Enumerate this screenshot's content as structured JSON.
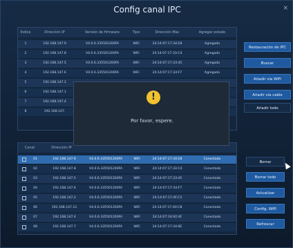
{
  "window": {
    "title": "Config canal IPC",
    "close": "×"
  },
  "top_table": {
    "headers": [
      "Índice",
      "Dirección IP",
      "Versión de firmware",
      "Tipo",
      "Dirección Mac",
      "Agregar estado"
    ],
    "rows": [
      [
        "1",
        "192.168.147.9",
        "V4.0.6.335501200FA",
        "WiFi",
        "24:14:07:17:34:E8",
        "Agregado"
      ],
      [
        "2",
        "192.168.147.8",
        "V4.0.6.335501200FA",
        "WiFi",
        "24:14:07:17:33:C4",
        "Agregado"
      ],
      [
        "3",
        "192.168.147.5",
        "V4.0.6.335501200FA",
        "WiFi",
        "24:14:07:17:33:45",
        "Agregado"
      ],
      [
        "4",
        "192.168.147.6",
        "V4.0.6.335501200FA",
        "WiFi",
        "24:14:07:17:34:F7",
        "Agregado"
      ],
      [
        "5",
        "192.168.147.2",
        "",
        "",
        "",
        ""
      ],
      [
        "6",
        "192.168.147.1",
        "",
        "",
        "",
        ""
      ],
      [
        "7",
        "192.168.147.4",
        "",
        "",
        "",
        ""
      ],
      [
        "8",
        "192.168.147.",
        "",
        "",
        "",
        ""
      ]
    ]
  },
  "bottom_table": {
    "headers": [
      "Canal",
      "Dirección IP",
      "",
      "",
      "",
      ""
    ],
    "rows": [
      [
        "01",
        "192.168.147.9",
        "V4.0.6.335501200FA",
        "WiFi",
        "24:14:07:17:34:E8",
        "Conectado"
      ],
      [
        "02",
        "192.168.147.8",
        "V4.0.6.335501200FA",
        "WiFi",
        "24:14:07:17:33:C4",
        "Conectado"
      ],
      [
        "03",
        "192.168.147.5",
        "V4.0.6.335501200FA",
        "WiFi",
        "24:14:07:17:33:45",
        "Conectado"
      ],
      [
        "04",
        "192.168.147.6",
        "V4.0.6.335501200FA",
        "WiFi",
        "24:14:07:17:34:F7",
        "Conectado"
      ],
      [
        "05",
        "192.168.147.2",
        "V4.0.6.335501200FA",
        "WiFi",
        "24:14:07:17:4F:C3",
        "Conectado"
      ],
      [
        "06",
        "192.168.147.12",
        "V4.0.6.335501200FA",
        "WiFi",
        "24:14:07:17:40:C8",
        "Conectado"
      ],
      [
        "07",
        "192.168.147.4",
        "V4.0.6.335501200FA",
        "WiFi",
        "24:14:07:16:92:4F",
        "Conectado"
      ],
      [
        "08",
        "192.168.147.7",
        "V4.0.6.335501200FA",
        "WiFi",
        "24:14:07:17:34:8E",
        "Conectado"
      ]
    ]
  },
  "buttons_top": [
    "Restauración de IPC",
    "Buscar",
    "Añadir vía WiFi",
    "Añadir vía cable",
    "Añadir todo"
  ],
  "buttons_bottom": [
    "Borrar",
    "Borrar todo",
    "Actualizar",
    "Config. WiFi",
    "Refrescar"
  ],
  "dialog": {
    "icon": "!",
    "message": "Por favor, espere."
  },
  "colors": {
    "selected_row": "#2f6cb0",
    "button": "#1f5aa0",
    "warning": "#f2c12e"
  }
}
